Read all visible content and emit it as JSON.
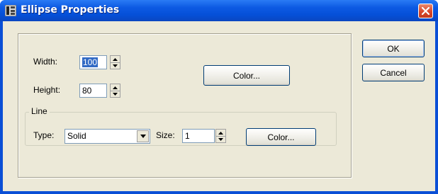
{
  "window": {
    "title": "Ellipse Properties"
  },
  "fields": {
    "width_label": "Width:",
    "width_value": "100",
    "height_label": "Height:",
    "height_value": "80",
    "color_button": "Color..."
  },
  "line_group": {
    "legend": "Line",
    "type_label": "Type:",
    "type_value": "Solid",
    "size_label": "Size:",
    "size_value": "1",
    "color_button": "Color..."
  },
  "buttons": {
    "ok": "OK",
    "cancel": "Cancel"
  },
  "colors": {
    "titlebar": "#0a4fd6",
    "dialog_bg": "#ece9d8",
    "selection": "#316ac5"
  },
  "icons": {
    "app": "grid-app-icon",
    "close": "close-icon",
    "spin_up": "spin-up-icon",
    "spin_down": "spin-down-icon",
    "dropdown": "chevron-down-icon"
  }
}
